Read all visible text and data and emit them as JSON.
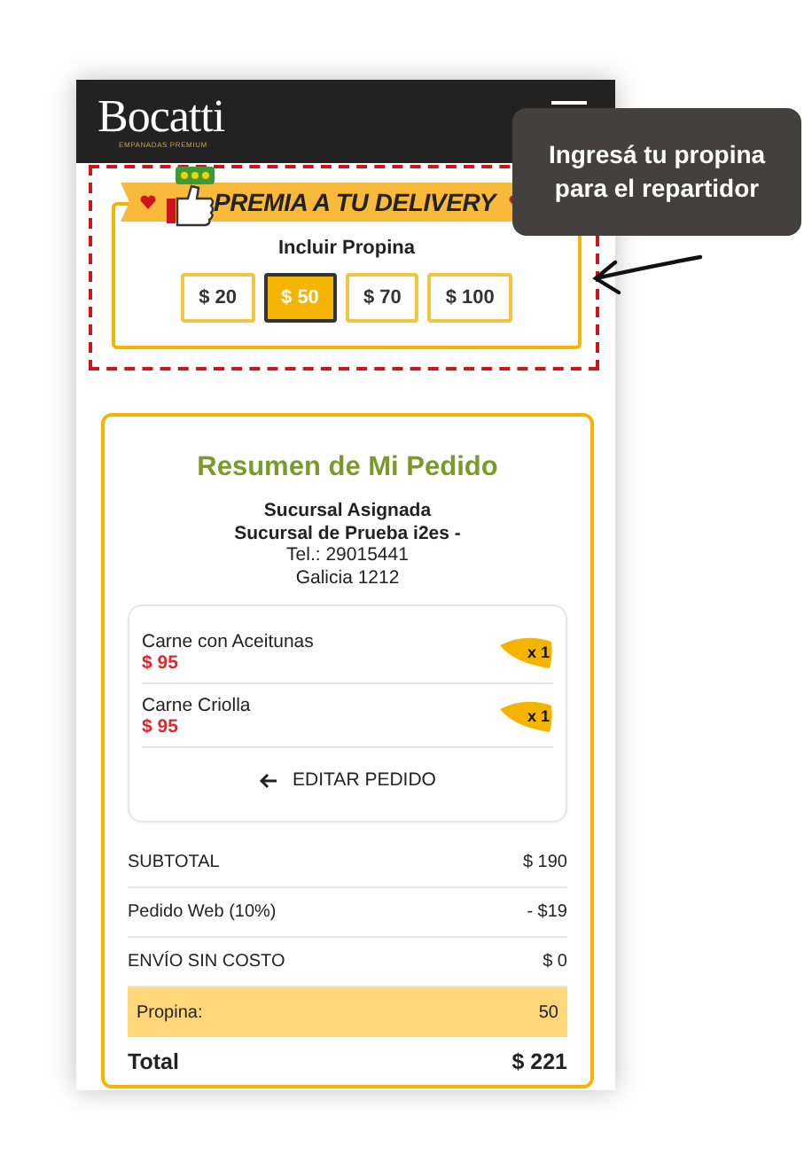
{
  "header": {
    "logo": "Bocatti",
    "tagline": "EMPANADAS PREMIUM"
  },
  "tip": {
    "banner": "PREMIA A TU DELIVERY",
    "label": "Incluir Propina",
    "options": [
      {
        "label": "$ 20",
        "selected": false
      },
      {
        "label": "$ 50",
        "selected": true
      },
      {
        "label": "$ 70",
        "selected": false
      },
      {
        "label": "$ 100",
        "selected": false
      }
    ]
  },
  "summary": {
    "title": "Resumen de Mi Pedido",
    "branch_heading": "Sucursal Asignada",
    "branch_name": "Sucursal de Prueba i2es -",
    "phone": "Tel.: 29015441",
    "address": "Galicia 1212",
    "items": [
      {
        "name": "Carne con Aceitunas",
        "price": "$ 95",
        "quantity": "x 1"
      },
      {
        "name": "Carne Criolla",
        "price": "$ 95",
        "quantity": "x 1"
      }
    ],
    "edit_button": "EDITAR PEDIDO",
    "totals": [
      {
        "kind": "line",
        "label": "SUBTOTAL",
        "value": "$ 190"
      },
      {
        "kind": "line",
        "label": "Pedido Web (10%)",
        "value": "- $19"
      },
      {
        "kind": "line",
        "label": "ENVÍO SIN COSTO",
        "value": "$ 0"
      },
      {
        "kind": "tip",
        "label": "Propina:",
        "value": "50"
      },
      {
        "kind": "total",
        "label": "Total",
        "value": "$ 221"
      }
    ]
  },
  "callout": {
    "text": "Ingresá tu propina para el repartidor"
  }
}
